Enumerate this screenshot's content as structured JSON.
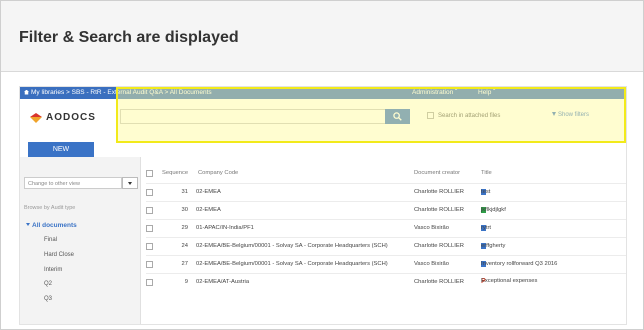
{
  "caption": {
    "title": "Filter & Search are displayed"
  },
  "topbar": {
    "breadcrumb": "My libraries  > SBS - RtR - External Audit Q&A  > All Documents",
    "admin_label": "Administration ˇ",
    "help_label": "Help ˇ"
  },
  "logo": {
    "text": "AODOCS"
  },
  "search": {
    "placeholder": "",
    "attached_label": "Search in attached files",
    "show_filters": "Show filters"
  },
  "new_button": "NEW",
  "sidebar": {
    "change_view": "Change to other view",
    "browse_label": "Browse by Audit type",
    "root": "All documents",
    "items": [
      "Final",
      "Hard Close",
      "Interim",
      "Q2",
      "Q3"
    ]
  },
  "table": {
    "headers": [
      "Sequence",
      "Company Code",
      "Document creator",
      "Title"
    ],
    "rows": [
      {
        "sequence": "31",
        "company": "02-EMEA",
        "creator": "Charlotte ROLLIER",
        "title": "test",
        "icon": "doc"
      },
      {
        "sequence": "30",
        "company": "02-EMEA",
        "creator": "Charlotte ROLLIER",
        "title": "jkflkjdjlgkf",
        "icon": "sheet"
      },
      {
        "sequence": "29",
        "company": "01-APAC/IN-India/PF1",
        "creator": "Vasco Bixirão",
        "title": "rytrt",
        "icon": "doc"
      },
      {
        "sequence": "24",
        "company": "02-EMEA/BE-Belgium/00001 - Solvay SA - Corporate Headquarters (SCH)",
        "creator": "Charlotte ROLLIER",
        "title": "erffgherty",
        "icon": "doc"
      },
      {
        "sequence": "27",
        "company": "02-EMEA/BE-Belgium/00001 - Solvay SA - Corporate Headquarters (SCH)",
        "creator": "Vasco Bixirão",
        "title": "Inventory rollforward Q3 2016",
        "icon": "doc"
      },
      {
        "sequence": "9",
        "company": "02-EMEA/AT-Austria",
        "creator": "Charlotte ROLLIER",
        "title": "Exceptional expenses",
        "icon": "ppt"
      }
    ]
  },
  "colors": {
    "brand_blue": "#3a73c6",
    "highlight": "#f2ea1a"
  }
}
